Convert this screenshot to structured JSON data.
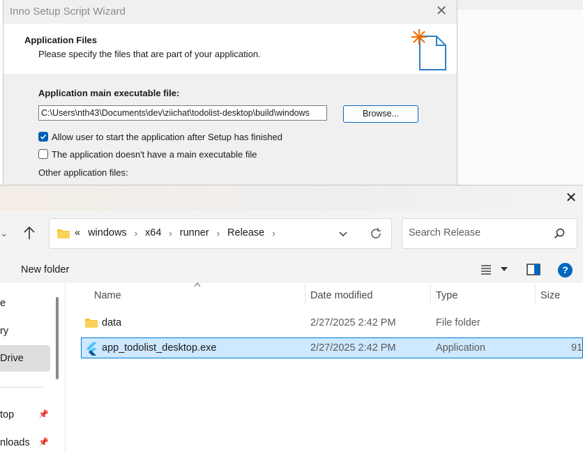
{
  "wizard": {
    "title": "Inno Setup Script Wizard",
    "header_title": "Application Files",
    "header_subtitle": "Please specify the files that are part of your application.",
    "main_exe_label": "Application main executable file:",
    "main_exe_value": "C:\\Users\\nth43\\Documents\\dev\\ziichat\\todolist-desktop\\build\\windows",
    "browse_label": "Browse...",
    "allow_start_label": "Allow user to start the application after Setup has finished",
    "allow_start_checked": true,
    "no_main_exe_label": "The application doesn't have a main executable file",
    "no_main_exe_checked": false,
    "other_files_label": "Other application files:"
  },
  "explorer": {
    "breadcrumb_overflow": "«",
    "breadcrumb": [
      "windows",
      "x64",
      "runner",
      "Release"
    ],
    "search_placeholder": "Search Release",
    "new_folder_label": "New folder",
    "help_label": "?",
    "nav_items": [
      {
        "label": "e",
        "selected": false,
        "pinned": false
      },
      {
        "label": "ry",
        "selected": false,
        "pinned": false
      },
      {
        "label": "Drive",
        "selected": true,
        "pinned": false
      },
      {
        "label": "top",
        "selected": false,
        "pinned": true
      },
      {
        "label": "nloads",
        "selected": false,
        "pinned": true
      }
    ],
    "columns": {
      "name": "Name",
      "date": "Date modified",
      "type": "Type",
      "size": "Size"
    },
    "files": [
      {
        "name": "data",
        "date": "2/27/2025 2:42 PM",
        "type": "File folder",
        "size": "",
        "icon": "folder-icon",
        "selected": false
      },
      {
        "name": "app_todolist_desktop.exe",
        "date": "2/27/2025 2:42 PM",
        "type": "Application",
        "size": "91",
        "icon": "flutter-app-icon",
        "selected": true
      }
    ]
  },
  "colors": {
    "accent": "#0067c0",
    "selection": "#cde8ff",
    "folder": "#f8c53a"
  }
}
